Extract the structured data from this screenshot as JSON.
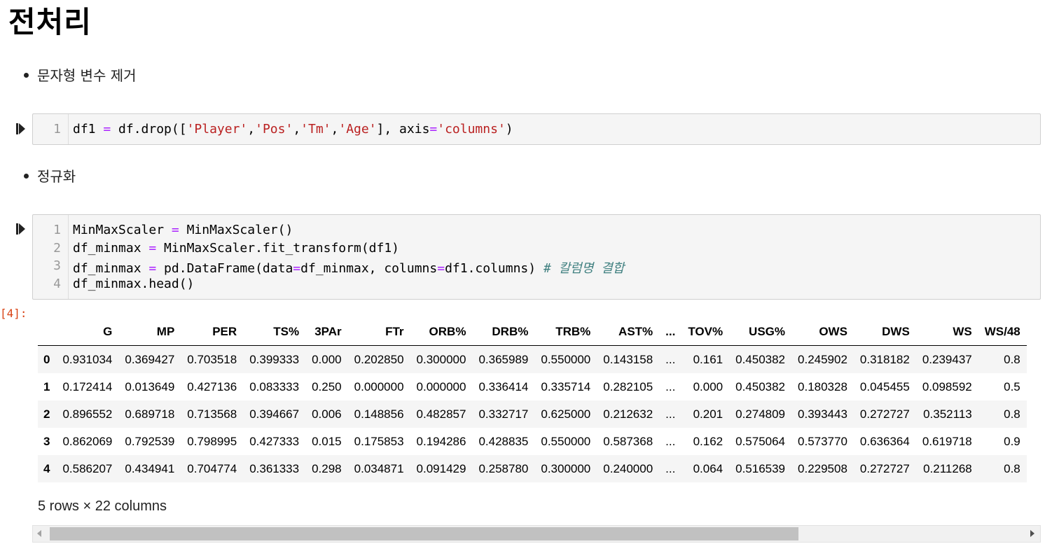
{
  "heading": "전처리",
  "bullets": [
    "문자형 변수 제거",
    "정규화"
  ],
  "cell1": {
    "line_numbers": [
      "1"
    ],
    "code": {
      "p1": "df1 ",
      "op1": "=",
      "p2": " df.drop([",
      "s1": "'Player'",
      "c1": ",",
      "s2": "'Pos'",
      "c2": ",",
      "s3": "'Tm'",
      "c3": ",",
      "s4": "'Age'",
      "p3": "], axis",
      "op2": "=",
      "s5": "'columns'",
      "p4": ")"
    }
  },
  "cell2": {
    "line_numbers": [
      "1",
      "2",
      "3",
      "4"
    ],
    "l1": {
      "a": "MinMaxScaler ",
      "op": "=",
      "b": " MinMaxScaler()"
    },
    "l2": {
      "a": "df_minmax ",
      "op": "=",
      "b": " MinMaxScaler.fit_transform(df1)"
    },
    "l3": {
      "a": "df_minmax ",
      "op": "=",
      "b": " pd.DataFrame(data",
      "op2": "=",
      "c": "df_minmax, columns",
      "op3": "=",
      "d": "df1.columns) ",
      "comment": "# 칼럼명 결합"
    },
    "l4": "df_minmax.head()"
  },
  "out_prompt": "[4]:",
  "table": {
    "columns": [
      "G",
      "MP",
      "PER",
      "TS%",
      "3PAr",
      "FTr",
      "ORB%",
      "DRB%",
      "TRB%",
      "AST%",
      "...",
      "TOV%",
      "USG%",
      "OWS",
      "DWS",
      "WS",
      "WS/48"
    ],
    "rows": [
      {
        "idx": "0",
        "cells": [
          "0.931034",
          "0.369427",
          "0.703518",
          "0.399333",
          "0.000",
          "0.202850",
          "0.300000",
          "0.365989",
          "0.550000",
          "0.143158",
          "...",
          "0.161",
          "0.450382",
          "0.245902",
          "0.318182",
          "0.239437",
          "0.8"
        ]
      },
      {
        "idx": "1",
        "cells": [
          "0.172414",
          "0.013649",
          "0.427136",
          "0.083333",
          "0.250",
          "0.000000",
          "0.000000",
          "0.336414",
          "0.335714",
          "0.282105",
          "...",
          "0.000",
          "0.450382",
          "0.180328",
          "0.045455",
          "0.098592",
          "0.5"
        ]
      },
      {
        "idx": "2",
        "cells": [
          "0.896552",
          "0.689718",
          "0.713568",
          "0.394667",
          "0.006",
          "0.148856",
          "0.482857",
          "0.332717",
          "0.625000",
          "0.212632",
          "...",
          "0.201",
          "0.274809",
          "0.393443",
          "0.272727",
          "0.352113",
          "0.8"
        ]
      },
      {
        "idx": "3",
        "cells": [
          "0.862069",
          "0.792539",
          "0.798995",
          "0.427333",
          "0.015",
          "0.175853",
          "0.194286",
          "0.428835",
          "0.550000",
          "0.587368",
          "...",
          "0.162",
          "0.575064",
          "0.573770",
          "0.636364",
          "0.619718",
          "0.9"
        ]
      },
      {
        "idx": "4",
        "cells": [
          "0.586207",
          "0.434941",
          "0.704774",
          "0.361333",
          "0.298",
          "0.034871",
          "0.091429",
          "0.258780",
          "0.300000",
          "0.240000",
          "...",
          "0.064",
          "0.516539",
          "0.229508",
          "0.272727",
          "0.211268",
          "0.8"
        ]
      }
    ]
  },
  "rows_info": "5 rows × 22 columns",
  "scrollbar": {
    "thumb_fraction": 0.74
  }
}
